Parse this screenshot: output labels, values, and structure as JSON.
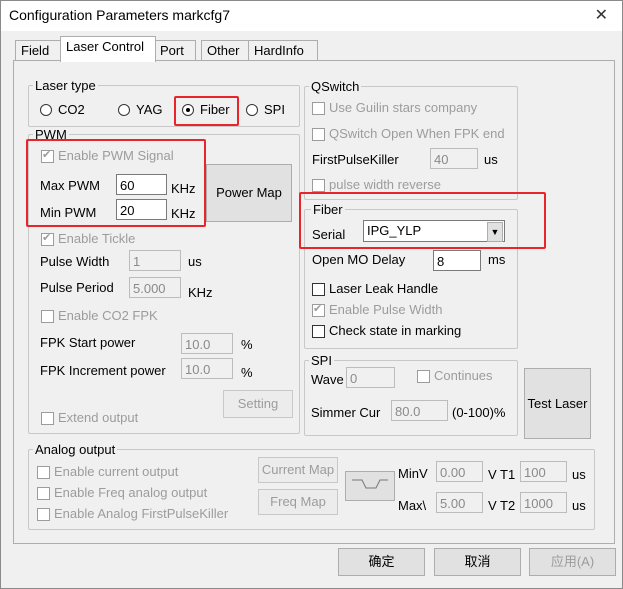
{
  "window": {
    "title": "Configuration Parameters markcfg7",
    "close_glyph": "✕"
  },
  "tabs": [
    "Field",
    "Laser Control",
    "Port",
    "Other",
    "HardInfo"
  ],
  "laser_type": {
    "title": "Laser type",
    "options": [
      "CO2",
      "YAG",
      "Fiber",
      "SPI"
    ],
    "selected": "Fiber"
  },
  "pwm": {
    "title": "PWM",
    "enable_label": "Enable PWM Signal",
    "max_label": "Max PWM",
    "max_value": "60",
    "max_unit": "KHz",
    "min_label": "Min PWM",
    "min_value": "20",
    "min_unit": "KHz",
    "power_map_button": "Power Map",
    "enable_tickle_label": "Enable Tickle",
    "pulse_width_label": "Pulse Width",
    "pulse_width_value": "1",
    "pulse_width_unit": "us",
    "pulse_period_label": "Pulse Period",
    "pulse_period_value": "5.000",
    "pulse_period_unit": "KHz",
    "enable_co2_fpk_label": "Enable CO2 FPK",
    "fpk_start_label": "FPK Start power",
    "fpk_start_value": "10.0",
    "fpk_start_unit": "%",
    "fpk_inc_label": "FPK Increment power",
    "fpk_inc_value": "10.0",
    "fpk_inc_unit": "%",
    "setting_button": "Setting",
    "extend_output_label": "Extend output"
  },
  "qswitch": {
    "title": "QSwitch",
    "guilin_label": "Use Guilin stars company",
    "open_when_fpk_label": "QSwitch Open When FPK end",
    "fpk_label": "FirstPulseKiller",
    "fpk_value": "40",
    "fpk_unit": "us",
    "pulse_reverse_label": "pulse width reverse"
  },
  "fiber": {
    "title": "Fiber",
    "serial_label": "Serial",
    "serial_value": "IPG_YLP",
    "open_mo_label": "Open MO Delay",
    "open_mo_value": "8",
    "open_mo_unit": "ms",
    "leak_label": "Laser Leak Handle",
    "enable_pulse_width_label": "Enable Pulse Width",
    "check_state_label": "Check state in marking"
  },
  "spi": {
    "title": "SPI",
    "wave_label": "Wave",
    "wave_value": "0",
    "continues_label": "Continues",
    "simmer_label": "Simmer Cur",
    "simmer_value": "80.0",
    "simmer_unit": "(0-100)%"
  },
  "test_laser_button": "Test Laser",
  "analog": {
    "title": "Analog output",
    "enable_current_label": "Enable current output",
    "enable_freq_label": "Enable Freq analog output",
    "enable_fpk_label": "Enable Analog FirstPulseKiller",
    "current_map_button": "Current Map",
    "freq_map_button": "Freq Map",
    "minv_label": "MinV",
    "minv_value": "0.00",
    "maxv_label": "Max\\",
    "maxv_value": "5.00",
    "t1_label": "V T1",
    "t1_value": "100",
    "t1_unit": "us",
    "t2_label": "V T2",
    "t2_value": "1000",
    "t2_unit": "us"
  },
  "footer": {
    "ok": "确定",
    "cancel": "取消",
    "apply": "应用(A)"
  },
  "colors": {
    "highlight": "#e8262a"
  }
}
